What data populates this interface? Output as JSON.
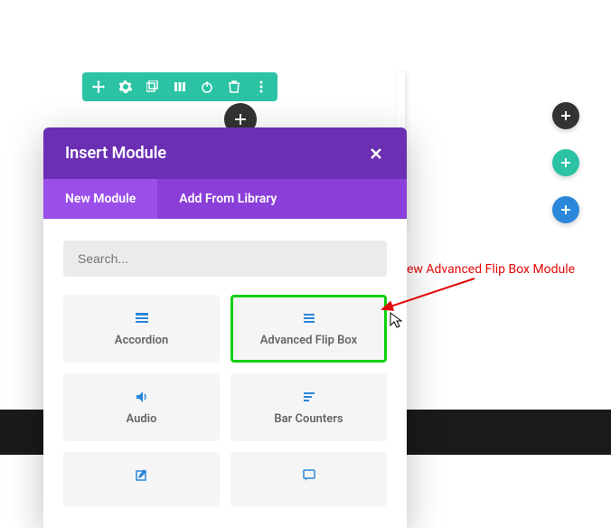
{
  "toolbar": {
    "icons": [
      "move",
      "settings",
      "duplicate",
      "columns",
      "power",
      "delete",
      "more"
    ]
  },
  "modal": {
    "title": "Insert Module",
    "tabs": {
      "new": "New Module",
      "library": "Add From Library"
    },
    "search_placeholder": "Search...",
    "modules": [
      {
        "label": "Accordion",
        "icon": "accordion"
      },
      {
        "label": "Advanced Flip Box",
        "icon": "menu"
      },
      {
        "label": "Audio",
        "icon": "audio"
      },
      {
        "label": "Bar Counters",
        "icon": "bars"
      },
      {
        "label": "",
        "icon": "edit"
      },
      {
        "label": "",
        "icon": "chat"
      }
    ]
  },
  "annotation": "New Advanced Flip Box Module",
  "colors": {
    "teal": "#2bc3a3",
    "purple_dark": "#6b2fb3",
    "purple_mid": "#8b3fd9",
    "purple_light": "#9b4fe9",
    "blue": "#2b87da",
    "icon_blue": "#2b87da",
    "green_border": "#11d011",
    "red": "#e20a0a"
  }
}
